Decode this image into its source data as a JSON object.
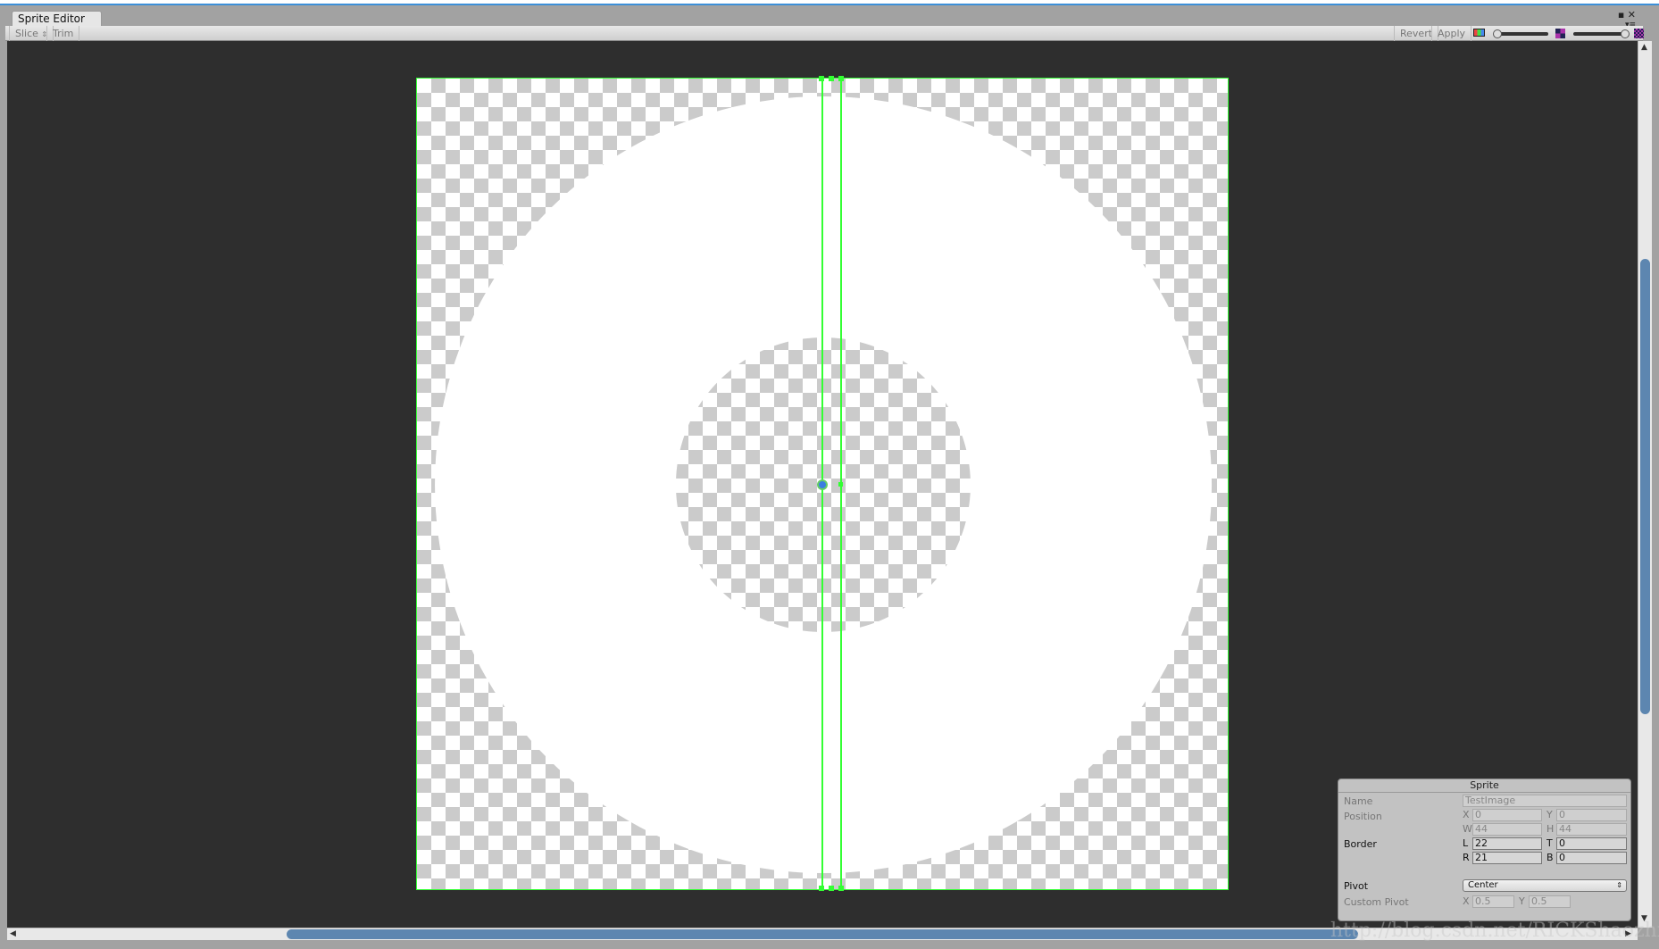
{
  "window": {
    "tab": "Sprite Editor",
    "maximize_icon": "maximize-icon",
    "close_icon": "close-icon",
    "menu_icon": "menu-icon"
  },
  "toolbar": {
    "slice": "Slice",
    "trim": "Trim",
    "revert": "Revert",
    "apply": "Apply",
    "color_toggle_icon": "rgb-channel-icon",
    "zoom_slider_value": 0,
    "mip_slider_value": 1
  },
  "sprite_panel": {
    "title": "Sprite",
    "name_label": "Name",
    "name_value": "TestImage",
    "position_label": "Position",
    "x": "0",
    "y": "0",
    "w": "44",
    "h": "44",
    "border_label": "Border",
    "l": "22",
    "t": "0",
    "r": "21",
    "b": "0",
    "pivot_label": "Pivot",
    "pivot_value": "Center",
    "custom_pivot_label": "Custom Pivot",
    "cx": "0.5",
    "cy": "0.5",
    "letters": {
      "x": "X",
      "y": "Y",
      "w": "W",
      "h": "H",
      "l": "L",
      "t": "T",
      "r": "R",
      "b": "B"
    }
  },
  "watermark": "http://blog.csdn.net/RICKShaozhiheng",
  "colors": {
    "guide": "#33ff33",
    "pivot": "#3a7de0",
    "canvas_bg": "#2e2e2e",
    "scroll_thumb": "#5d86b0"
  }
}
